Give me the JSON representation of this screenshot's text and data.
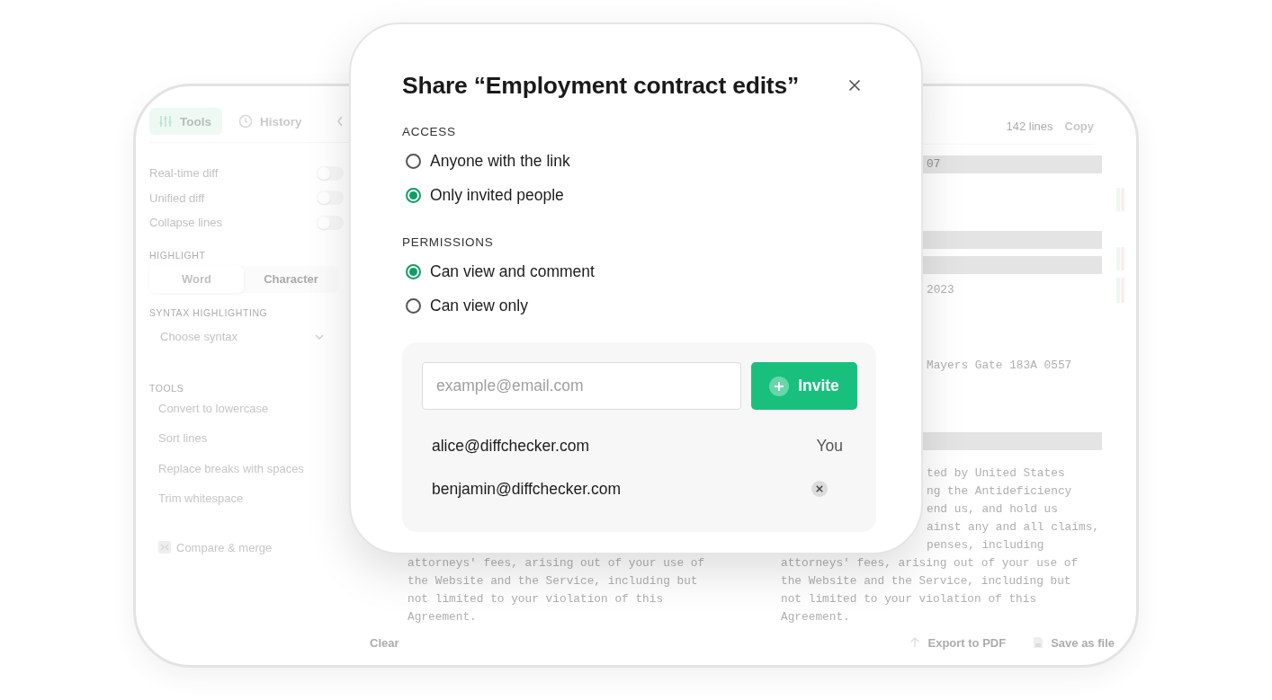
{
  "sidebar": {
    "tabs": [
      {
        "label": "Tools",
        "selected": true
      },
      {
        "label": "History",
        "selected": false
      }
    ],
    "toggles": [
      {
        "label": "Real-time diff",
        "on": false
      },
      {
        "label": "Unified diff",
        "on": false
      },
      {
        "label": "Collapse lines",
        "on": false
      }
    ],
    "highlight": {
      "heading": "HIGHLIGHT",
      "options": [
        {
          "label": "Word",
          "selected": true
        },
        {
          "label": "Character",
          "selected": false
        }
      ]
    },
    "syntax": {
      "heading": "SYNTAX HIGHLIGHTING",
      "dropdown": "Choose syntax"
    },
    "tools": {
      "heading": "TOOLS",
      "items": [
        "Convert to lowercase",
        "Sort lines",
        "Replace breaks with spaces",
        "Trim whitespace"
      ]
    },
    "compare_button": "Compare & merge"
  },
  "editor": {
    "line_count": "142 lines",
    "copy_button": "Copy",
    "left_lines": [
      "attorneys' fees, arising out of your use of",
      "the Website and the Service, including but",
      "not limited to your violation of this",
      "Agreement."
    ],
    "right_rows": [
      {
        "text": "07",
        "highlighted": true
      },
      {
        "highlighted": false
      },
      {
        "highlighted": false
      },
      {
        "highlighted": true
      },
      {
        "highlighted": true
      },
      {
        "text": "2023",
        "highlighted": false
      },
      {
        "highlighted": false
      },
      {
        "highlighted": false
      },
      {
        "text": "Mayers Gate 183A 0557",
        "highlighted": false
      },
      {
        "highlighted": false
      },
      {
        "highlighted": false
      },
      {
        "highlighted": true
      }
    ],
    "right_fragments": [
      "ted by United States",
      "ng the Antideficiency",
      "end us, and hold us",
      "ainst any and all claims,",
      "penses, including"
    ],
    "right_lines": [
      "attorneys' fees, arising out of your use of",
      "the Website and the Service, including but",
      "not limited to your violation of this",
      "Agreement."
    ]
  },
  "toolbar": {
    "clear_button": "Clear",
    "export_button": "Export to PDF",
    "save_button": "Save as file"
  },
  "share_dialog": {
    "title": "Share “Employment contract edits”",
    "access": {
      "heading": "ACCESS",
      "options": [
        {
          "label": "Anyone with the link",
          "selected": false
        },
        {
          "label": "Only invited people",
          "selected": true
        }
      ]
    },
    "permissions": {
      "heading": "PERMISSIONS",
      "options": [
        {
          "label": "Can view and comment",
          "selected": true
        },
        {
          "label": "Can view only",
          "selected": false
        }
      ]
    },
    "invite": {
      "placeholder": "example@email.com",
      "button": "Invite"
    },
    "members": [
      {
        "kind": "owner",
        "email": "alice@diffchecker.com",
        "role": "You"
      },
      {
        "kind": "invited",
        "email": "benjamin@diffchecker.com"
      }
    ]
  }
}
